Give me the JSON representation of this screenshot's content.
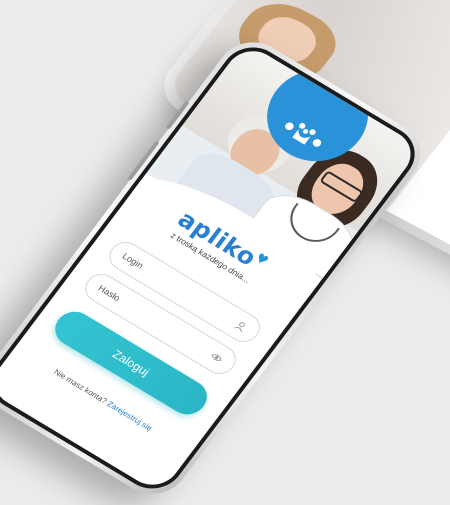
{
  "colors": {
    "brand_blue": "#2a92d8",
    "accent_teal": "#34c4d1",
    "link_blue": "#2a7fd1",
    "orange": "#f4a623"
  },
  "app": {
    "brand_name": "apliko",
    "tagline": "z troską każdego dnia..."
  },
  "form": {
    "login_placeholder": "Login",
    "password_placeholder": "Hasło",
    "submit_label": "Zaloguj"
  },
  "signup": {
    "question": "Nie masz konta?",
    "link_label": "Zarejestruj się"
  },
  "icons": {
    "logo": "family-flowers-icon",
    "login_field": "user-icon",
    "password_field": "eye-icon",
    "back_logo": "house-icon"
  }
}
